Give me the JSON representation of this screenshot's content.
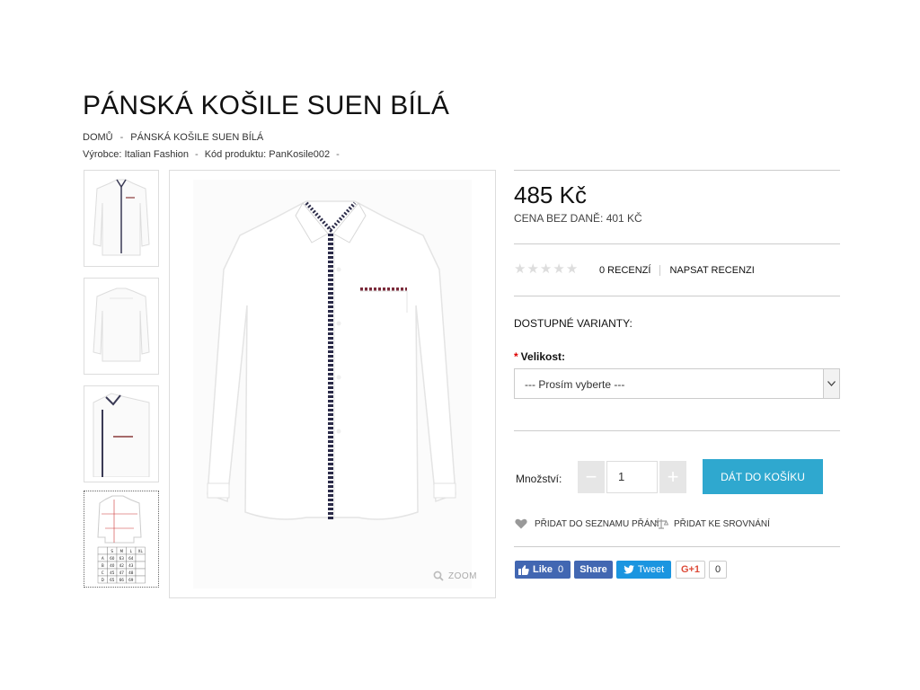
{
  "product": {
    "title": "PÁNSKÁ KOŠILE SUEN BÍLÁ",
    "breadcrumb": [
      "DOMŮ",
      "PÁNSKÁ KOŠILE SUEN BÍLÁ"
    ],
    "manufacturer_label": "Výrobce:",
    "manufacturer": "Italian Fashion",
    "code_label": "Kód produktu:",
    "code": "PanKosile002",
    "price": "485 Kč",
    "price_excl_tax": "CENA BEZ DANĚ: 401 KČ",
    "rating_stars": 0,
    "reviews_link": "0 RECENZÍ",
    "write_review": "NAPSAT RECENZI",
    "variants_heading": "DOSTUPNÉ VARIANTY:",
    "size_label": "Velikost:",
    "size_required_mark": "*",
    "size_select_value": "--- Prosím vyberte ---",
    "quantity_label": "Množství:",
    "quantity_value": "1",
    "minus": "−",
    "plus": "+",
    "add_to_cart": "DÁT DO KOŠÍKU",
    "wishlist": "PŘIDAT DO SEZNAMU PŘÁNÍ",
    "compare": "PŘIDAT KE SROVNÁNÍ",
    "zoom": "ZOOM"
  },
  "size_table": {
    "headers": [
      "S",
      "M",
      "L",
      "XL"
    ],
    "rows": [
      [
        "A",
        "60",
        "63",
        "64",
        ""
      ],
      [
        "B",
        "40",
        "42",
        "43",
        ""
      ],
      [
        "C",
        "45",
        "47",
        "48",
        ""
      ],
      [
        "D",
        "65",
        "66",
        "69",
        ""
      ]
    ]
  },
  "social": {
    "fb_like": "Like",
    "fb_like_count": "0",
    "fb_share": "Share",
    "tweet": "Tweet",
    "gplus": "G+1",
    "gplus_count": "0"
  },
  "colors": {
    "accent": "#2fa8cf",
    "facebook": "#4267b2",
    "twitter": "#1b95e0",
    "required": "#dd0000"
  }
}
